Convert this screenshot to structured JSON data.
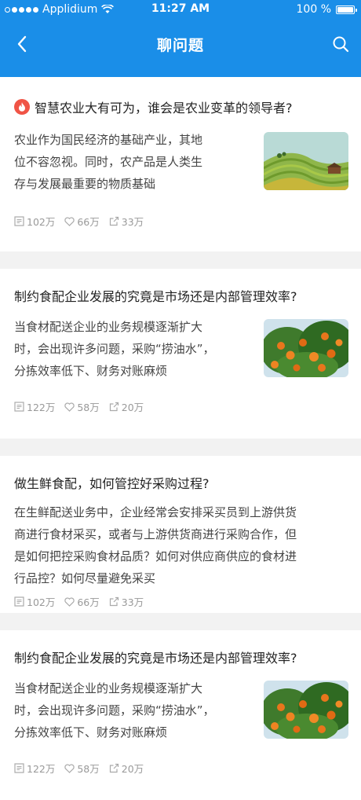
{
  "status": {
    "carrier": "Applidium",
    "time": "11:27 AM",
    "battery": "100 %"
  },
  "nav": {
    "title": "聊问题"
  },
  "icons": {
    "back": "chevron-left-icon",
    "search": "search-icon",
    "hot": "flame-icon",
    "views": "views-icon",
    "likes": "heart-icon",
    "share": "share-icon"
  },
  "colors": {
    "header": "#1a8ee8",
    "hot_badge": "#f05446"
  },
  "cards": [
    {
      "title": "智慧农业大有可为，谁会是农业变革的领导者?",
      "lines": [
        "农业作为国民经济的基础产业，其地",
        "位不容忽视。同时，农产品是人类生",
        "存与发展最重要的物质基础"
      ],
      "views": "102万",
      "likes": "66万",
      "shares": "33万"
    },
    {
      "title": "制约食配企业发展的究竟是市场还是内部管理效率?",
      "lines": [
        "当食材配送企业的业务规模逐渐扩大",
        "时，会出现许多问题，采购“捞油水”，",
        "分拣效率低下、财务对账麻烦"
      ],
      "views": "122万",
      "likes": "58万",
      "shares": "20万"
    },
    {
      "title": "做生鲜食配，如何管控好采购过程?",
      "lines": [
        "在生鲜配送业务中，企业经常会安排采买员到上游供货",
        "商进行食材采买，或者与上游供货商进行采购合作，但",
        "是如何把控采购食材品质？如何对供应商供应的食材进",
        "行品控？如何尽量避免采买"
      ],
      "views": "102万",
      "likes": "66万",
      "shares": "33万"
    },
    {
      "title": "制约食配企业发展的究竟是市场还是内部管理效率?",
      "lines": [
        "当食材配送企业的业务规模逐渐扩大",
        "时，会出现许多问题，采购“捞油水”，",
        "分拣效率低下、财务对账麻烦"
      ],
      "views": "122万",
      "likes": "58万",
      "shares": "20万"
    }
  ]
}
